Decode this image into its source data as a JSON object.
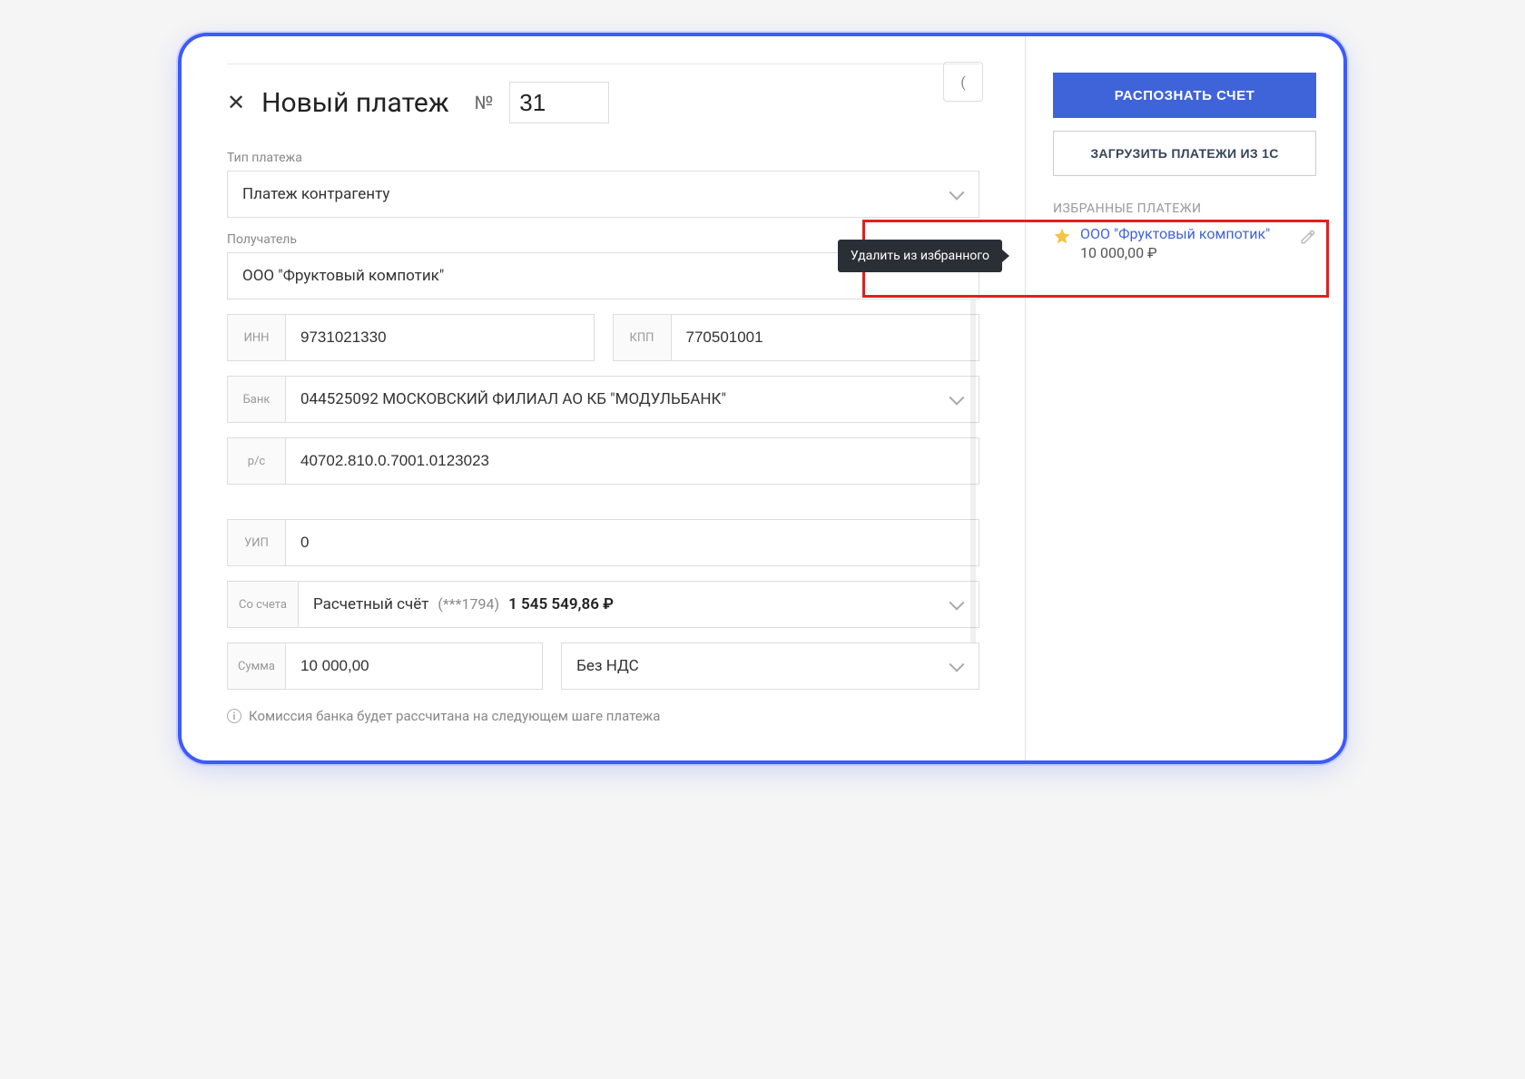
{
  "header": {
    "title": "Новый платеж",
    "number_label": "№",
    "number_value": "31"
  },
  "labels": {
    "payment_type": "Тип платежа",
    "recipient": "Получатель",
    "inn": "ИНН",
    "kpp": "КПП",
    "bank": "Банк",
    "account_rs": "р/с",
    "uip": "УИП",
    "from_account": "Со счета",
    "amount": "Сумма"
  },
  "form": {
    "payment_type_value": "Платеж контрагенту",
    "recipient_value": "ООО \"Фруктовый компотик\"",
    "inn_value": "9731021330",
    "kpp_value": "770501001",
    "bank_value": "044525092 МОСКОВСКИЙ ФИЛИАЛ АО КБ \"МОДУЛЬБАНК\"",
    "rs_value": "40702.810.0.7001.0123023",
    "uip_value": "0",
    "from_account": {
      "name": "Расчетный счёт",
      "mask": "(***1794)",
      "balance": "1 545 549,86 ₽"
    },
    "amount_value": "10 000,00",
    "vat_value": "Без НДС"
  },
  "info_note": "Комиссия банка будет рассчитана на следующем шаге платежа",
  "sidebar": {
    "recognize_btn": "РАСПОЗНАТЬ СЧЕТ",
    "load_btn": "ЗАГРУЗИТЬ ПЛАТЕЖИ ИЗ 1С",
    "fav_heading": "ИЗБРАННЫЕ ПЛАТЕЖИ",
    "fav_item": {
      "name": "ООО \"Фруктовый компотик\"",
      "amount": "10 000,00 ₽"
    }
  },
  "tooltip_text": "Удалить из избранного",
  "colors": {
    "primary": "#3f63d9",
    "highlight": "#e02020"
  }
}
